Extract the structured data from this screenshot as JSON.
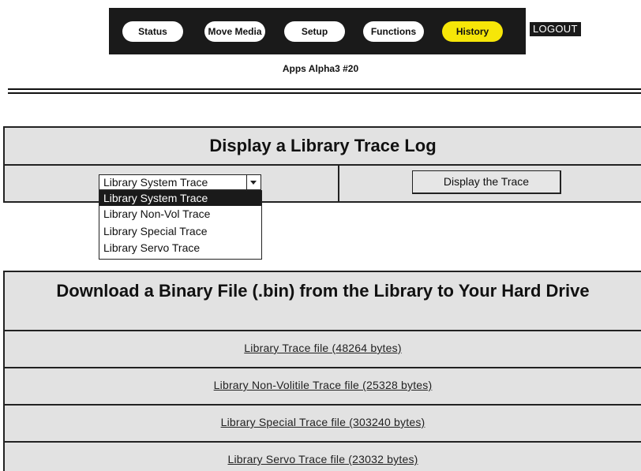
{
  "nav": {
    "items": [
      {
        "label": "Status"
      },
      {
        "label": "Move Media"
      },
      {
        "label": "Setup"
      },
      {
        "label": "Functions"
      },
      {
        "label": "History",
        "active": true
      }
    ],
    "logout_label": "LOGOUT",
    "active_color": "#f6e608",
    "bar_color": "#1a1a1a"
  },
  "subtitle": "Apps Alpha3 #20",
  "trace": {
    "title": "Display a Library Trace Log",
    "select_value": "Library System Trace",
    "options": [
      "Library System Trace",
      "Library Non-Vol Trace",
      "Library Special Trace",
      "Library Servo Trace"
    ],
    "highlighted_option": "Library System Trace",
    "button_label": "Display the Trace"
  },
  "download": {
    "title": "Download a Binary File (.bin) from the Library to Your Hard Drive",
    "files": [
      "Library Trace file (48264 bytes)",
      "Library Non-Volitile Trace file (25328 bytes)",
      "Library Special Trace file (303240 bytes)",
      "Library Servo Trace file (23032 bytes)"
    ]
  }
}
